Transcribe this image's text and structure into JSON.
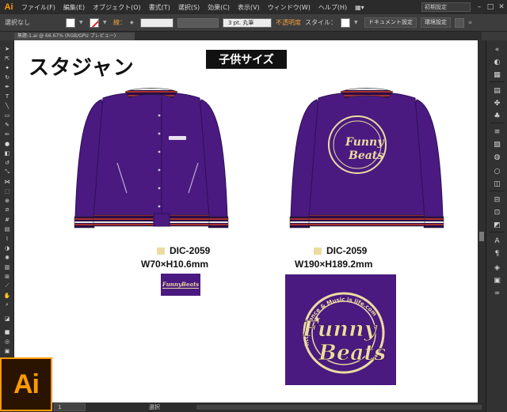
{
  "app": {
    "logo": "Ai"
  },
  "menu": [
    "ファイル(F)",
    "編集(E)",
    "オブジェクト(O)",
    "書式(T)",
    "選択(S)",
    "効果(C)",
    "表示(V)",
    "ウィンドウ(W)",
    "ヘルプ(H)"
  ],
  "workspace": "初期設定",
  "control": {
    "selection": "選択なし",
    "stroke_label": "線：",
    "stroke_value": "3 pt. 丸筆",
    "opacity_label": "不透明度",
    "style_label": "スタイル：",
    "doc_settings": "ドキュメント設定",
    "prefs": "環境設定"
  },
  "tab": {
    "label": "無題-1.ai @ 66.67% (RGB/GPU プレビュー)"
  },
  "artboard": {
    "title": "スタジャン",
    "badge": "子供サイズ",
    "front_spec": {
      "color": "DIC-2059",
      "size": "W70×H10.6mm"
    },
    "back_spec": {
      "color": "DIC-2059",
      "size": "W190×H189.2mm"
    },
    "logo_small_text": "FunnyBeats",
    "logo_large": {
      "line1": "Funny",
      "line2": "Beats",
      "ring_text": "http://Dance & Music is life.com"
    }
  },
  "status": {
    "zoom": "1",
    "mode": "選択"
  },
  "big_logo": "Ai",
  "colors": {
    "jacket": "#4a1a80",
    "accent": "#ff9a00",
    "print": "#ecdca0",
    "stripe_red": "#a8322a"
  }
}
